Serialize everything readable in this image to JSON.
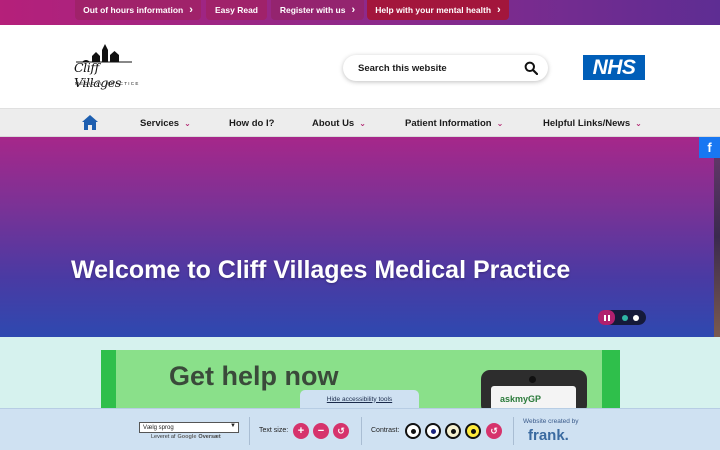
{
  "topbar": {
    "links": [
      {
        "label": "Out of hours information"
      },
      {
        "label": "Easy Read"
      },
      {
        "label": "Register with us"
      },
      {
        "label": "Help with your mental health"
      }
    ]
  },
  "header": {
    "logo_script": "Cliff Villages",
    "logo_sub": "MEDICAL PRACTICE",
    "search_placeholder": "Search this website",
    "nhs_logo": "NHS"
  },
  "nav": {
    "items": [
      {
        "label": "Services",
        "has_dropdown": true
      },
      {
        "label": "How do I?",
        "has_dropdown": false
      },
      {
        "label": "About Us",
        "has_dropdown": true
      },
      {
        "label": "Patient Information",
        "has_dropdown": true
      },
      {
        "label": "Helpful Links/News",
        "has_dropdown": true
      }
    ]
  },
  "hero": {
    "title": "Welcome to Cliff Villages Medical Practice",
    "facebook": "f"
  },
  "banner": {
    "title": "Get help now",
    "app_name": "askmyGP"
  },
  "accessibility": {
    "hide_label": "Hide accessibility tools",
    "language_select": "Vælg sprog",
    "powered_by": "Leveret af",
    "google": "Google",
    "translate": "Oversæt",
    "text_size_label": "Text size:",
    "contrast_label": "Contrast:",
    "credit_label": "Website created by",
    "credit_brand": "frank."
  },
  "colors": {
    "accent": "#b0206e",
    "nhs_blue": "#005eb8",
    "facebook": "#1877f2"
  }
}
